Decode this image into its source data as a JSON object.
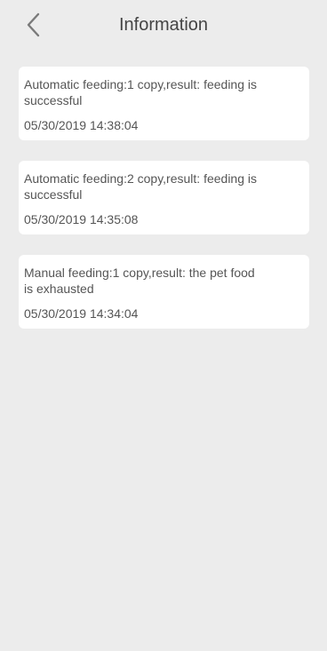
{
  "header": {
    "title": "Information",
    "back_icon": "chevron-left-icon"
  },
  "messages": [
    {
      "text": "Automatic feeding:1 copy,result: feeding is successful",
      "time": "05/30/2019 14:38:04"
    },
    {
      "text": "Automatic feeding:2 copy,result: feeding is successful",
      "time": "05/30/2019 14:35:08"
    },
    {
      "text": "Manual feeding:1 copy,result: the pet food is exhausted",
      "time": "05/30/2019 14:34:04"
    }
  ],
  "colors": {
    "background": "#ececec",
    "card": "#ffffff",
    "text": "#555555"
  }
}
